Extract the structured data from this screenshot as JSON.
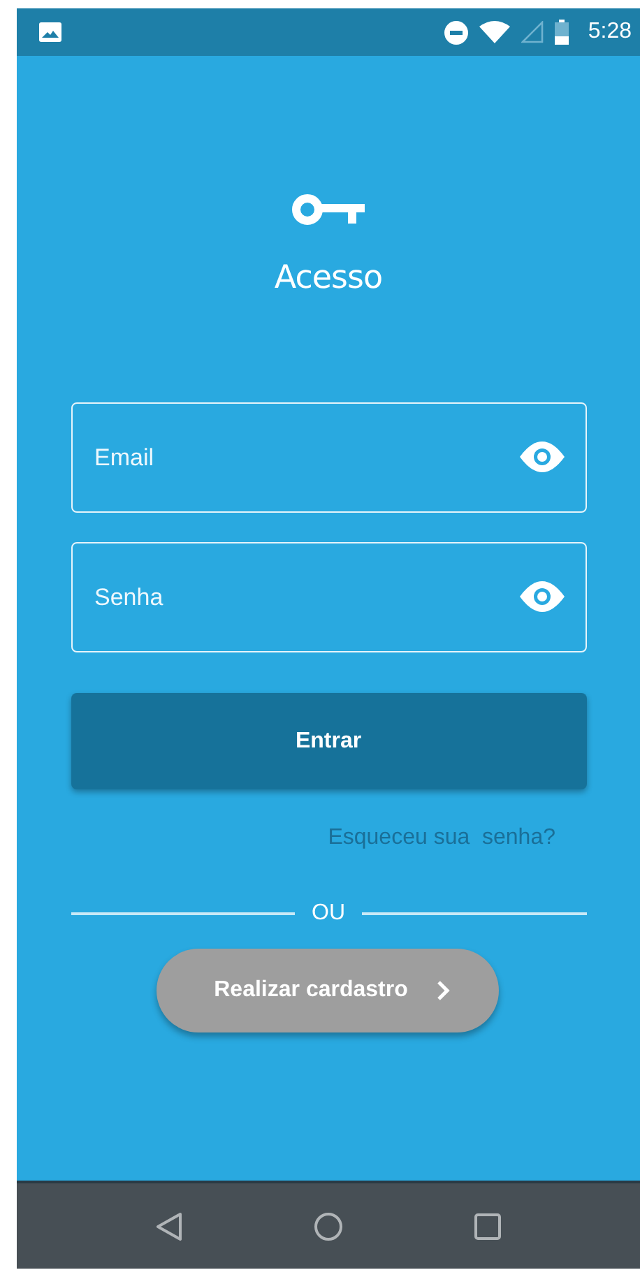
{
  "status_bar": {
    "time": "5:28"
  },
  "title": "Acesso",
  "fields": [
    {
      "placeholder": "Email"
    },
    {
      "placeholder": "Senha"
    }
  ],
  "login_button": "Entrar",
  "forgot_link": "Esqueceu sua  senha?",
  "divider": "OU",
  "register_button": "Realizar cardastro"
}
